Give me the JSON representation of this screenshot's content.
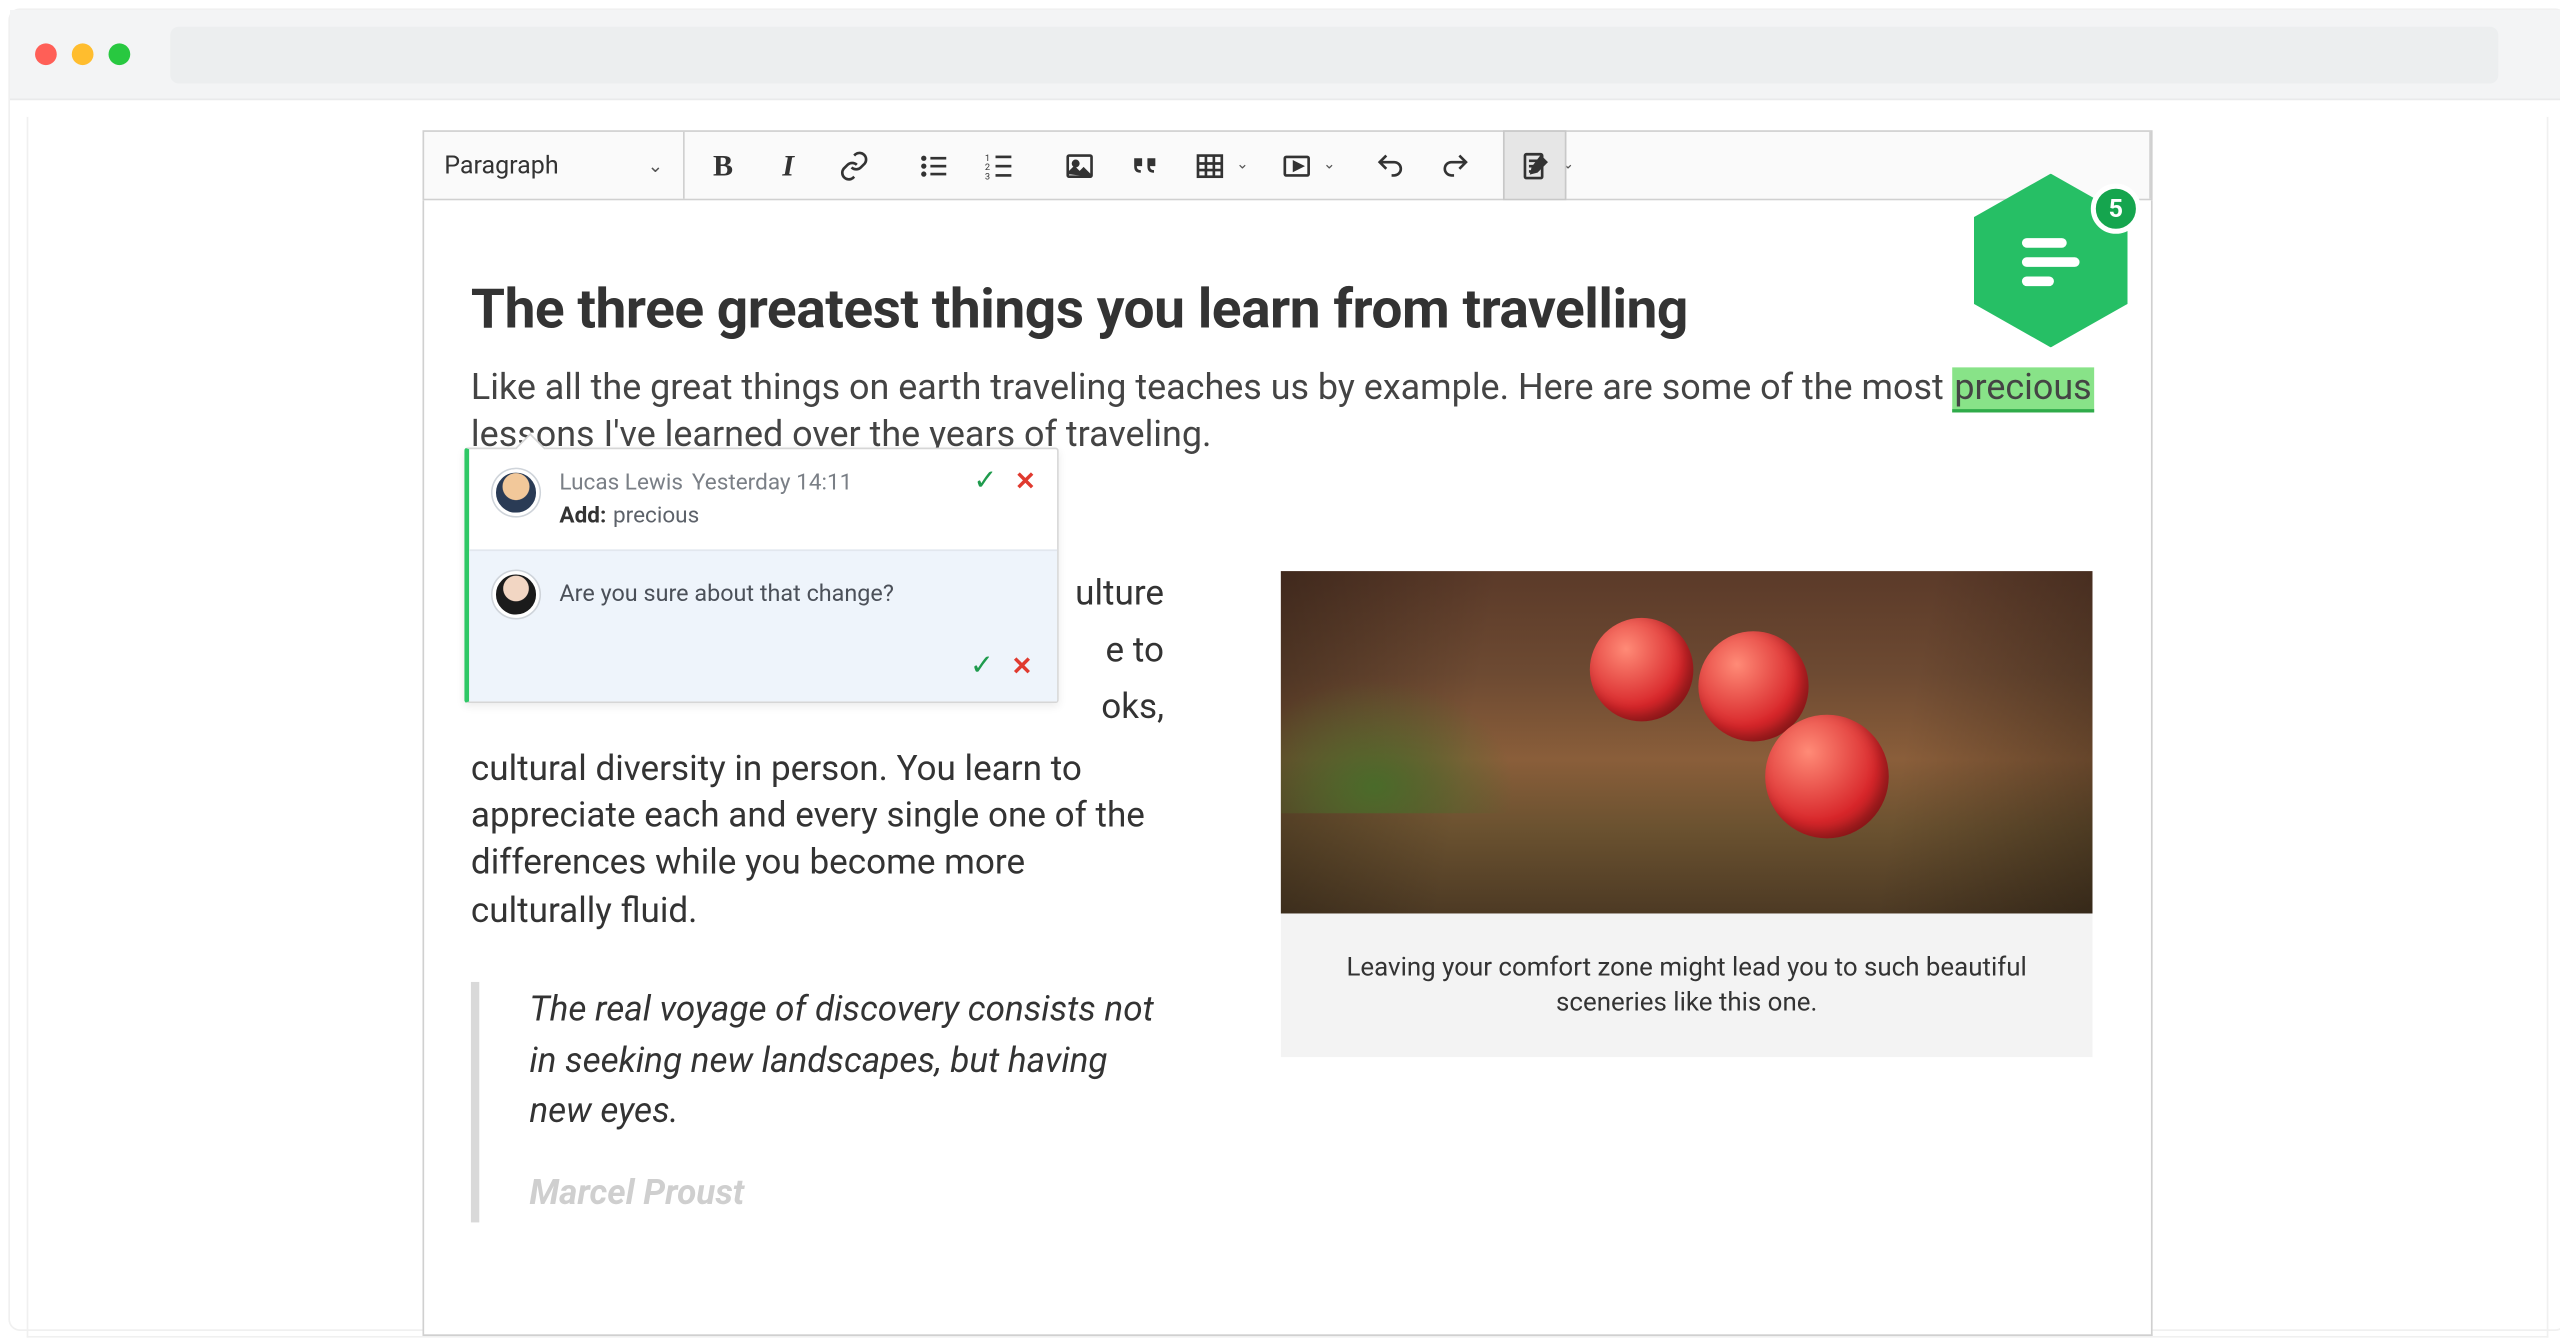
{
  "toolbar": {
    "heading_label": "Paragraph"
  },
  "document": {
    "title": "The three greatest things you learn from travelling",
    "intro_before": "Like all the great things on earth traveling teaches us by example. Here are some of the most ",
    "highlighted_word": "precious",
    "intro_after": " lessons I've learned over the years of traveling.",
    "section_frag_1": "ulture",
    "section_frag_2": "e to",
    "section_frag_3": "oks,",
    "body_paragraph": "cultural diversity in person. You learn to appreciate each and every single one of the differences while you become more culturally fluid.",
    "quote_text": "The real voyage of discovery consists not in seeking new landscapes, but having new eyes.",
    "quote_author": "Marcel Proust",
    "caption": "Leaving your comfort zone might lead you to such beautiful sceneries like this one."
  },
  "suggestion": {
    "author": "Lucas Lewis",
    "timestamp": "Yesterday 14:11",
    "action_label": "Add:",
    "action_word": "precious",
    "reply_text": "Are you sure about that change?"
  },
  "badge": {
    "count": "5"
  }
}
